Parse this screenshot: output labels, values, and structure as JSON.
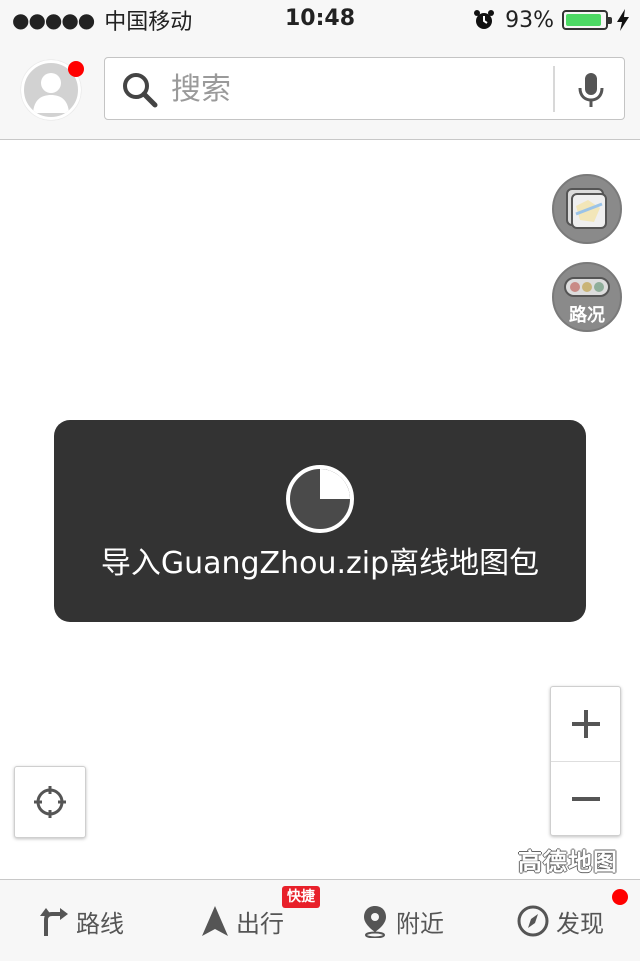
{
  "status_bar": {
    "signal_dots": "●●●●●",
    "carrier": "中国移动",
    "time": "10:48",
    "battery_percent": "93%",
    "battery_level": 0.93,
    "battery_color": "#4cd964"
  },
  "header": {
    "avatar_icon": "user-avatar-icon",
    "notification_color": "#ff0000",
    "search": {
      "placeholder": "搜索",
      "value": ""
    }
  },
  "map_controls": {
    "layers_icon": "map-layers-icon",
    "traffic_label": "路况",
    "zoom_in_icon": "plus-icon",
    "zoom_out_icon": "minus-icon",
    "locate_icon": "locate-crosshair-icon"
  },
  "toast": {
    "message": "导入GuangZhou.zip离线地图包",
    "progress": 0.25
  },
  "logo_text": "高德地图",
  "tab_bar": {
    "items": [
      {
        "label": "路线",
        "icon": "route-icon"
      },
      {
        "label": "出行",
        "icon": "navigation-arrow-icon",
        "badge": "快捷"
      },
      {
        "label": "附近",
        "icon": "location-pin-icon"
      },
      {
        "label": "发现",
        "icon": "compass-icon"
      }
    ]
  }
}
